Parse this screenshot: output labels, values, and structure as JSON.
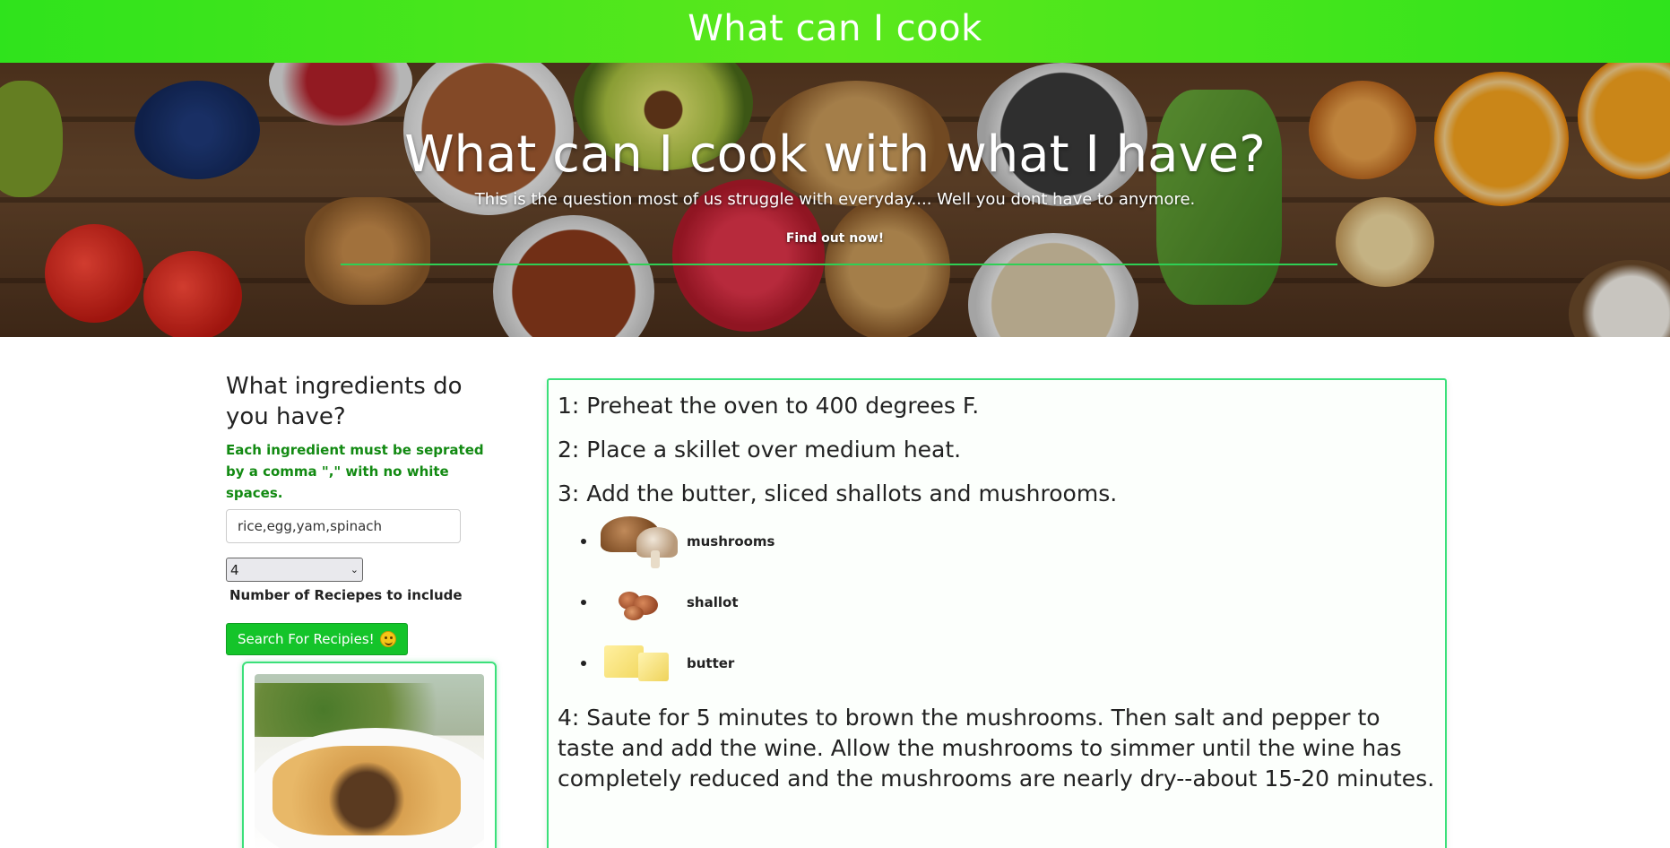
{
  "header": {
    "title": "What can I cook"
  },
  "hero": {
    "title": "What can I cook with what I have?",
    "subtitle": "This is the question most of us struggle with everyday.... Well you dont have to anymore.",
    "cta": "Find out now!"
  },
  "sidebar": {
    "heading": "What ingredients do you have?",
    "hint": "Each ingredient must be seprated by a comma \",\" with no white spaces.",
    "ingredients_value": "rice,egg,yam,spinach",
    "recipe_count_selected": "4",
    "recipe_count_label": "Number of Reciepes to include",
    "search_button": "Search For Recipies!",
    "search_button_icon": "smile-emoji-icon"
  },
  "instructions": {
    "steps": [
      "1: Preheat the oven to 400 degrees F.",
      "2: Place a skillet over medium heat.",
      "3: Add the butter, sliced shallots and mushrooms.",
      "4: Saute for 5 minutes to brown the mushrooms. Then salt and pepper to taste and add the wine. Allow the mushrooms to simmer until the wine has completely reduced and the mushrooms are nearly dry--about 15-20 minutes."
    ],
    "step3_ingredients": [
      {
        "name": "mushrooms",
        "icon": "mushroom-image"
      },
      {
        "name": "shallot",
        "icon": "shallot-image"
      },
      {
        "name": "butter",
        "icon": "butter-image"
      }
    ]
  },
  "colors": {
    "topbar": "#2fe31c",
    "accent_border": "#3be07a",
    "button": "#14c42a",
    "hint": "#128a12"
  }
}
